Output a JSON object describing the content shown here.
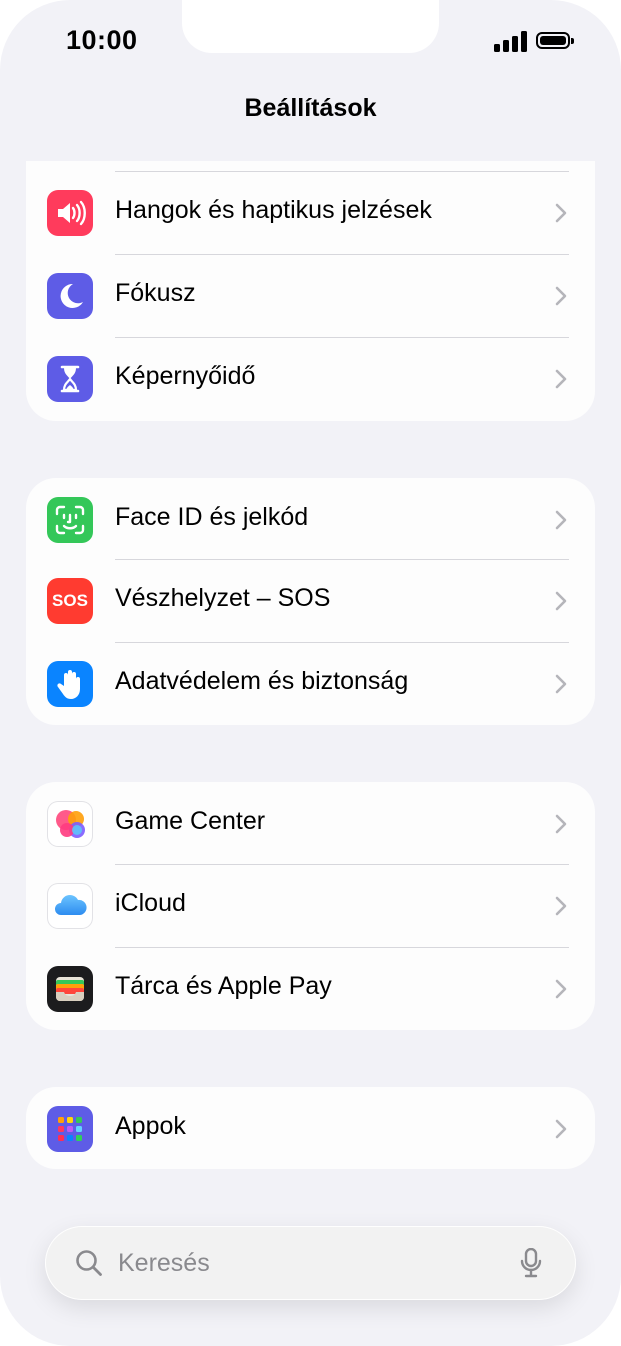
{
  "status_bar": {
    "time": "10:00"
  },
  "header": {
    "title": "Beállítások"
  },
  "groups": [
    {
      "items": [
        {
          "label": "Hangok és haptikus jelzések",
          "icon": "speaker-icon",
          "color": "#ff3b5c"
        },
        {
          "label": "Fókusz",
          "icon": "moon-icon",
          "color": "#5e5ce6"
        },
        {
          "label": "Képernyőidő",
          "icon": "hourglass-icon",
          "color": "#5e5ce6"
        }
      ]
    },
    {
      "items": [
        {
          "label": "Face ID és jelkód",
          "icon": "face-id-icon",
          "color": "#34c759"
        },
        {
          "label": "Vészhelyzet – SOS",
          "icon": "sos-icon",
          "icon_text": "SOS",
          "color": "#ff3b30"
        },
        {
          "label": "Adatvédelem és biztonság",
          "icon": "hand-icon",
          "color": "#0a84ff"
        }
      ]
    },
    {
      "items": [
        {
          "label": "Game Center",
          "icon": "game-center-icon",
          "color": "#ffffff"
        },
        {
          "label": "iCloud",
          "icon": "icloud-icon",
          "color": "#ffffff"
        },
        {
          "label": "Tárca és Apple Pay",
          "icon": "wallet-icon",
          "color": "#1c1c1e"
        }
      ]
    },
    {
      "items": [
        {
          "label": "Appok",
          "icon": "apps-grid-icon",
          "color": "#5e5ce6"
        }
      ]
    }
  ],
  "search": {
    "placeholder": "Keresés"
  }
}
